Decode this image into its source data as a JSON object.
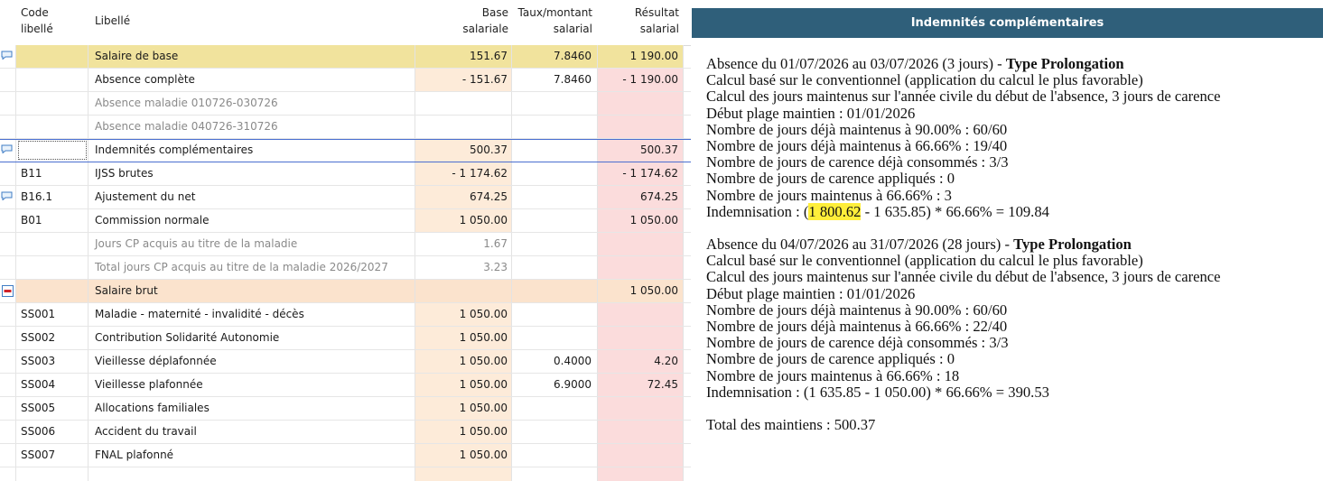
{
  "table": {
    "headers": {
      "code": [
        "Code",
        "libellé"
      ],
      "libelle": "Libellé",
      "base": [
        "Base",
        "salariale"
      ],
      "taux": [
        "Taux/montant",
        "salarial"
      ],
      "resultat": [
        "Résultat",
        "salarial"
      ]
    },
    "rows": [
      {
        "code": "",
        "libelle": "Salaire de base",
        "base": "151.67",
        "taux": "7.8460",
        "resultat": "1 190.00"
      },
      {
        "code": "",
        "libelle": "Absence complète",
        "base": "- 151.67",
        "taux": "7.8460",
        "resultat": "- 1 190.00"
      },
      {
        "code": "",
        "libelle": "Absence maladie 010726-030726",
        "base": "",
        "taux": "",
        "resultat": ""
      },
      {
        "code": "",
        "libelle": "Absence maladie 040726-310726",
        "base": "",
        "taux": "",
        "resultat": ""
      },
      {
        "code": "",
        "libelle": "Indemnités complémentaires",
        "base": "500.37",
        "taux": "",
        "resultat": "500.37"
      },
      {
        "code": "B11",
        "libelle": "IJSS brutes",
        "base": "- 1 174.62",
        "taux": "",
        "resultat": "- 1 174.62"
      },
      {
        "code": "B16.1",
        "libelle": "Ajustement du net",
        "base": "674.25",
        "taux": "",
        "resultat": "674.25"
      },
      {
        "code": "B01",
        "libelle": "Commission normale",
        "base": "1 050.00",
        "taux": "",
        "resultat": "1 050.00"
      },
      {
        "code": "",
        "libelle": "Jours CP acquis au titre de la maladie",
        "base": "1.67",
        "taux": "",
        "resultat": ""
      },
      {
        "code": "",
        "libelle": "Total jours CP acquis au titre de la maladie 2026/2027",
        "base": "3.23",
        "taux": "",
        "resultat": ""
      },
      {
        "code": "",
        "libelle": "Salaire brut",
        "base": "",
        "taux": "",
        "resultat": "1 050.00"
      },
      {
        "code": "SS001",
        "libelle": "Maladie - maternité - invalidité - décès",
        "base": "1 050.00",
        "taux": "",
        "resultat": ""
      },
      {
        "code": "SS002",
        "libelle": "Contribution Solidarité Autonomie",
        "base": "1 050.00",
        "taux": "",
        "resultat": ""
      },
      {
        "code": "SS003",
        "libelle": "Vieillesse déplafonnée",
        "base": "1 050.00",
        "taux": "0.4000",
        "resultat": "4.20"
      },
      {
        "code": "SS004",
        "libelle": "Vieillesse plafonnée",
        "base": "1 050.00",
        "taux": "6.9000",
        "resultat": "72.45"
      },
      {
        "code": "SS005",
        "libelle": "Allocations familiales",
        "base": "1 050.00",
        "taux": "",
        "resultat": ""
      },
      {
        "code": "SS006",
        "libelle": "Accident du travail",
        "base": "1 050.00",
        "taux": "",
        "resultat": ""
      },
      {
        "code": "SS007",
        "libelle": "FNAL plafonné",
        "base": "1 050.00",
        "taux": "",
        "resultat": ""
      }
    ]
  },
  "panel": {
    "title": "Indemnités complémentaires",
    "block1": {
      "period": "Absence du 01/07/2026 au 03/07/2026 (3 jours) - ",
      "type": "Type Prolongation",
      "l1": "Calcul basé sur le conventionnel (application du calcul le plus favorable)",
      "l2": "Calcul des jours maintenus sur l'année civile du début de l'absence, 3 jours de carence",
      "l3": "Début plage maintien : 01/01/2026",
      "l4": "Nombre de jours déjà maintenus à 90.00% : 60/60",
      "l5": "Nombre de jours déjà maintenus à 66.66% : 19/40",
      "l6": "Nombre de jours de carence déjà consommés : 3/3",
      "l7": "Nombre de jours de carence appliqués : 0",
      "l8": "Nombre de jours maintenus à 66.66% : 3",
      "ind_prefix": "Indemnisation : (",
      "ind_highlight": "1 800.62",
      "ind_suffix": " - 1 635.85) * 66.66% = 109.84"
    },
    "block2": {
      "period": "Absence du 04/07/2026 au 31/07/2026 (28 jours) - ",
      "type": "Type Prolongation",
      "l1": "Calcul basé sur le conventionnel (application du calcul le plus favorable)",
      "l2": "Calcul des jours maintenus sur l'année civile du début de l'absence, 3 jours de carence",
      "l3": "Début plage maintien : 01/01/2026",
      "l4": "Nombre de jours déjà maintenus à 90.00% : 60/60",
      "l5": "Nombre de jours déjà maintenus à 66.66% : 22/40",
      "l6": "Nombre de jours de carence déjà consommés : 3/3",
      "l7": "Nombre de jours de carence appliqués : 0",
      "l8": "Nombre de jours maintenus à 66.66% : 18",
      "ind": "Indemnisation : (1 635.85 - 1 050.00) * 66.66% = 390.53"
    },
    "total": "Total des maintiens : 500.37"
  }
}
